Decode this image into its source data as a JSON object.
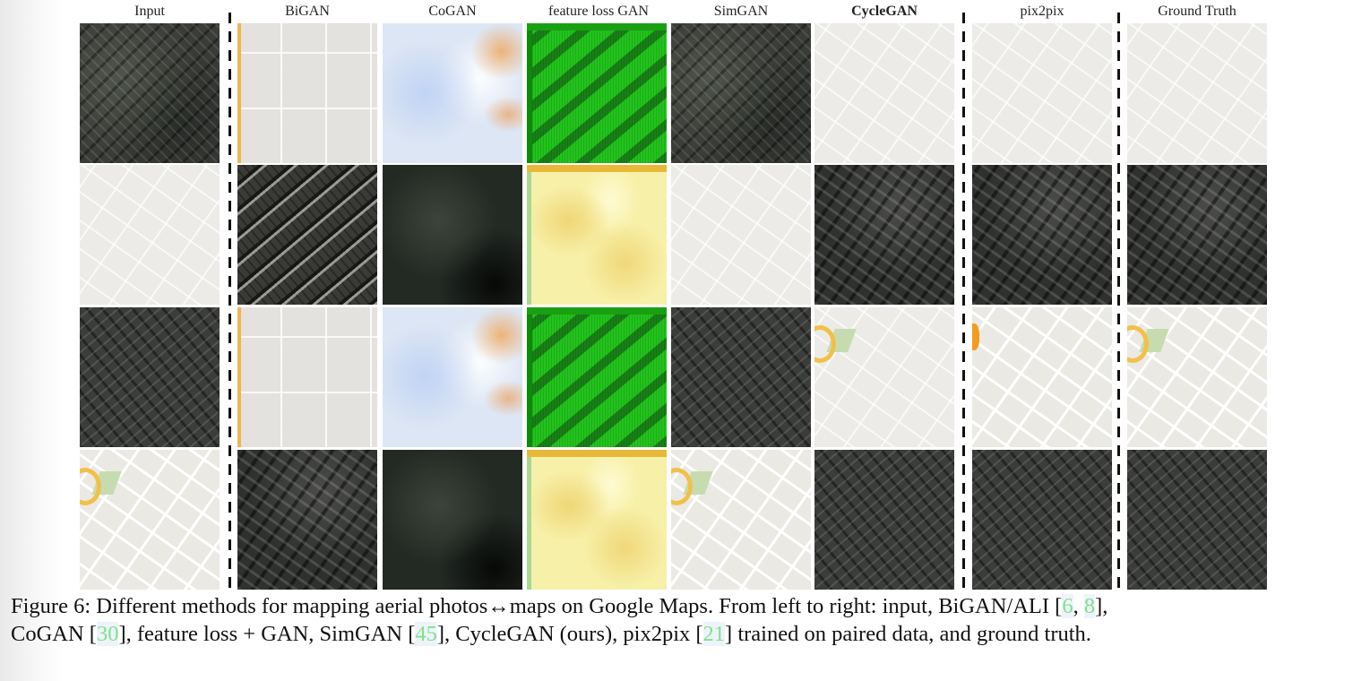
{
  "figure": {
    "columns": [
      {
        "id": "input",
        "label": "Input",
        "bold": false
      },
      {
        "id": "bigan",
        "label": "BiGAN",
        "bold": false
      },
      {
        "id": "cogan",
        "label": "CoGAN",
        "bold": false
      },
      {
        "id": "feature-loss-gan",
        "label": "feature loss GAN",
        "bold": false
      },
      {
        "id": "simgan",
        "label": "SimGAN",
        "bold": false
      },
      {
        "id": "cyclegan",
        "label": "CycleGAN",
        "bold": true
      },
      {
        "id": "pix2pix",
        "label": "pix2pix",
        "bold": false
      },
      {
        "id": "ground-truth",
        "label": "Ground Truth",
        "bold": false
      }
    ],
    "rows": [
      {
        "direction": "aerial-to-map",
        "tiles": [
          "aerial photo",
          "blank map with roads",
          "pale blue sky-like blur",
          "green artifact texture",
          "aerial photo",
          "map",
          "map",
          "map"
        ]
      },
      {
        "direction": "map-to-aerial",
        "tiles": [
          "map",
          "striped aerial photo",
          "dark blurry texture",
          "yellow blob texture",
          "map",
          "aerial photo",
          "aerial photo",
          "aerial photo"
        ]
      },
      {
        "direction": "aerial-to-map",
        "tiles": [
          "aerial photo",
          "blank map with roads",
          "pale blue sky-like blur",
          "green artifact texture",
          "aerial photo",
          "map with park",
          "map with orange landmark",
          "map with park"
        ]
      },
      {
        "direction": "map-to-aerial",
        "tiles": [
          "map with park",
          "aerial photo",
          "dark blurry texture",
          "yellow blob texture",
          "map with park",
          "aerial photo",
          "aerial photo",
          "aerial photo"
        ]
      }
    ],
    "caption": {
      "line1_a": "Figure 6: Different methods for mapping aerial photos↔maps on Google Maps. From left to right: input, BiGAN/ALI [",
      "cite1": "6",
      "line1_b": ", ",
      "cite2": "8",
      "line1_c": "],",
      "line2_a": "CoGAN [",
      "cite3": "30",
      "line2_b": "], feature loss + GAN, SimGAN [",
      "cite4": "45",
      "line2_c": "], CycleGAN (ours), pix2pix [",
      "cite5": "21",
      "line2_d": "] trained on paired data, and ground truth."
    },
    "colors": {
      "citation": "#7fe28b",
      "citation_bg": "#eef3fb"
    }
  }
}
